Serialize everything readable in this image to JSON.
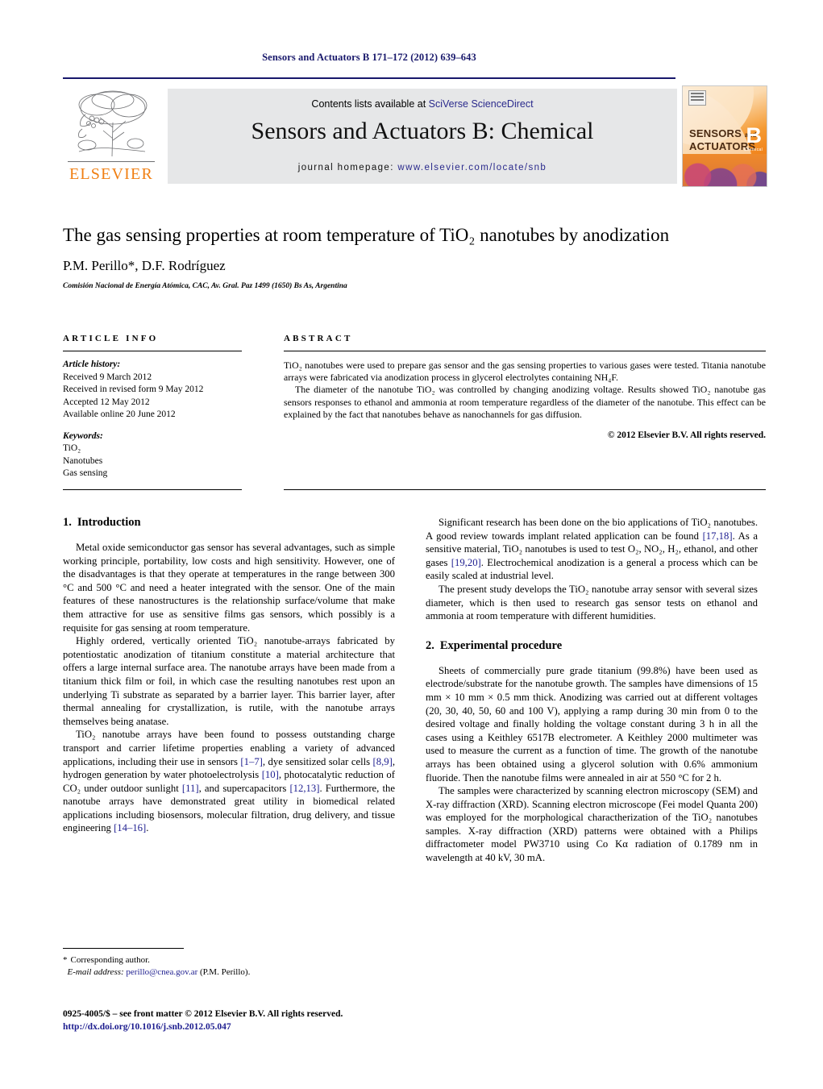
{
  "running_head": "Sensors and Actuators B 171–172 (2012) 639–643",
  "masthead": {
    "contents_prefix": "Contents lists available at ",
    "contents_link": "SciVerse ScienceDirect",
    "journal_title": "Sensors and Actuators B: Chemical",
    "homepage_label": "journal homepage: ",
    "homepage_url": "www.elsevier.com/locate/snb",
    "publisher_name": "ELSEVIER",
    "publisher_logo_icon": "elsevier-tree-icon",
    "cover": {
      "line1": "SENSORS",
      "and": "and",
      "line2": "ACTUATORS",
      "letter": "B",
      "sub": "Chemical"
    }
  },
  "title": "The gas sensing properties at room temperature of TiO₂ nanotubes by anodization",
  "authors": "P.M. Perillo*, D.F. Rodríguez",
  "affiliation": "Comisión Nacional de Energía Atómica, CAC, Av. Gral. Paz 1499 (1650) Bs As, Argentina",
  "article_info": {
    "heading": "ARTICLE INFO",
    "history_label": "Article history:",
    "history": [
      "Received 9 March 2012",
      "Received in revised form 9 May 2012",
      "Accepted 12 May 2012",
      "Available online 20 June 2012"
    ],
    "keywords_label": "Keywords:",
    "keywords": [
      "TiO₂",
      "Nanotubes",
      "Gas sensing"
    ]
  },
  "abstract": {
    "heading": "ABSTRACT",
    "p1": "TiO₂ nanotubes were used to prepare gas sensor and the gas sensing properties to various gases were tested. Titania nanotube arrays were fabricated via anodization process in glycerol electrolytes containing NH₄F.",
    "p2": "The diameter of the nanotube TiO₂ was controlled by changing anodizing voltage. Results showed TiO₂ nanotube gas sensors responses to ethanol and ammonia at room temperature regardless of the diameter of the nanotube. This effect can be explained by the fact that nanotubes behave as nanochannels for gas diffusion.",
    "copyright": "© 2012 Elsevier B.V. All rights reserved."
  },
  "sections": {
    "intro": {
      "number": "1.",
      "title": "Introduction",
      "p1": "Metal oxide semiconductor gas sensor has several advantages, such as simple working principle, portability, low costs and high sensitivity. However, one of the disadvantages is that they operate at temperatures in the range between 300 °C and 500 °C and need a heater integrated with the sensor. One of the main features of these nanostructures is the relationship surface/volume that make them attractive for use as sensitive films gas sensors, which possibly is a requisite for gas sensing at room temperature.",
      "p2": "Highly ordered, vertically oriented TiO₂ nanotube-arrays fabricated by potentiostatic anodization of titanium constitute a material architecture that offers a large internal surface area. The nanotube arrays have been made from a titanium thick film or foil, in which case the resulting nanotubes rest upon an underlying Ti substrate as separated by a barrier layer. This barrier layer, after thermal annealing for crystallization, is rutile, with the nanotube arrays themselves being anatase.",
      "p3_a": "TiO₂ nanotube arrays have been found to possess outstanding charge transport and carrier lifetime properties enabling a variety of advanced applications, including their use in sensors ",
      "p3_c1": "[1–7]",
      "p3_b": ", dye sensitized solar cells ",
      "p3_c2": "[8,9]",
      "p3_c": ", hydrogen generation by water photoelectrolysis ",
      "p3_c3": "[10]",
      "p3_d": ", photocatalytic reduction of CO₂ under outdoor sunlight ",
      "p3_c4": "[11]",
      "p3_e": ", and supercapacitors ",
      "p3_c5": "[12,13]",
      "p3_f": ". Furthermore, the nanotube arrays have demonstrated great utility in biomedical related applications including biosensors, molecular filtration, drug delivery, and tissue engineering ",
      "p3_c6": "[14–16]",
      "p3_g": ".",
      "p4_a": "Significant research has been done on the bio applications of TiO₂ nanotubes. A good review towards implant related application can be found ",
      "p4_c1": "[17,18]",
      "p4_b": ". As a sensitive material, TiO₂ nanotubes is used to test O₂, NO₂, H₂, ethanol, and other gases ",
      "p4_c2": "[19,20]",
      "p4_c": ". Electrochemical anodization is a general a process which can be easily scaled at industrial level.",
      "p5": "The present study develops the TiO₂ nanotube array sensor with several sizes diameter, which is then used to research gas sensor tests on ethanol and ammonia at room temperature with different humidities."
    },
    "experimental": {
      "number": "2.",
      "title": "Experimental procedure",
      "p1": "Sheets of commercially pure grade titanium (99.8%) have been used as electrode/substrate for the nanotube growth. The samples have dimensions of 15 mm × 10 mm × 0.5 mm thick. Anodizing was carried out at different voltages (20, 30, 40, 50, 60 and 100 V), applying a ramp during 30 min from 0 to the desired voltage and finally holding the voltage constant during 3 h in all the cases using a Keithley 6517B electrometer. A Keithley 2000 multimeter was used to measure the current as a function of time. The growth of the nanotube arrays has been obtained using a glycerol solution with 0.6% ammonium fluoride. Then the nanotube films were annealed in air at 550 °C for 2 h.",
      "p2": "The samples were characterized by scanning electron microscopy (SEM) and X-ray diffraction (XRD). Scanning electron microscope (Fei model Quanta 200) was employed for the morphological charactherization of the TiO₂ nanotubes samples. X-ray diffraction (XRD) patterns were obtained with a Philips diffractometer model PW3710 using Co Kα radiation of 0.1789 nm in wavelength at 40 kV, 30 mA."
    }
  },
  "footnotes": {
    "corresponding": "Corresponding author.",
    "email_label": "E-mail address:",
    "email": "perillo@cnea.gov.ar",
    "email_owner": "(P.M. Perillo)."
  },
  "footer": {
    "issn_line": "0925-4005/$ – see front matter © 2012 Elsevier B.V. All rights reserved.",
    "doi": "http://dx.doi.org/10.1016/j.snb.2012.05.047"
  },
  "colors": {
    "navy": "#18186b",
    "link": "#1d1d8f",
    "orange": "#f07f13",
    "panel_grey": "#e6e7e8"
  }
}
